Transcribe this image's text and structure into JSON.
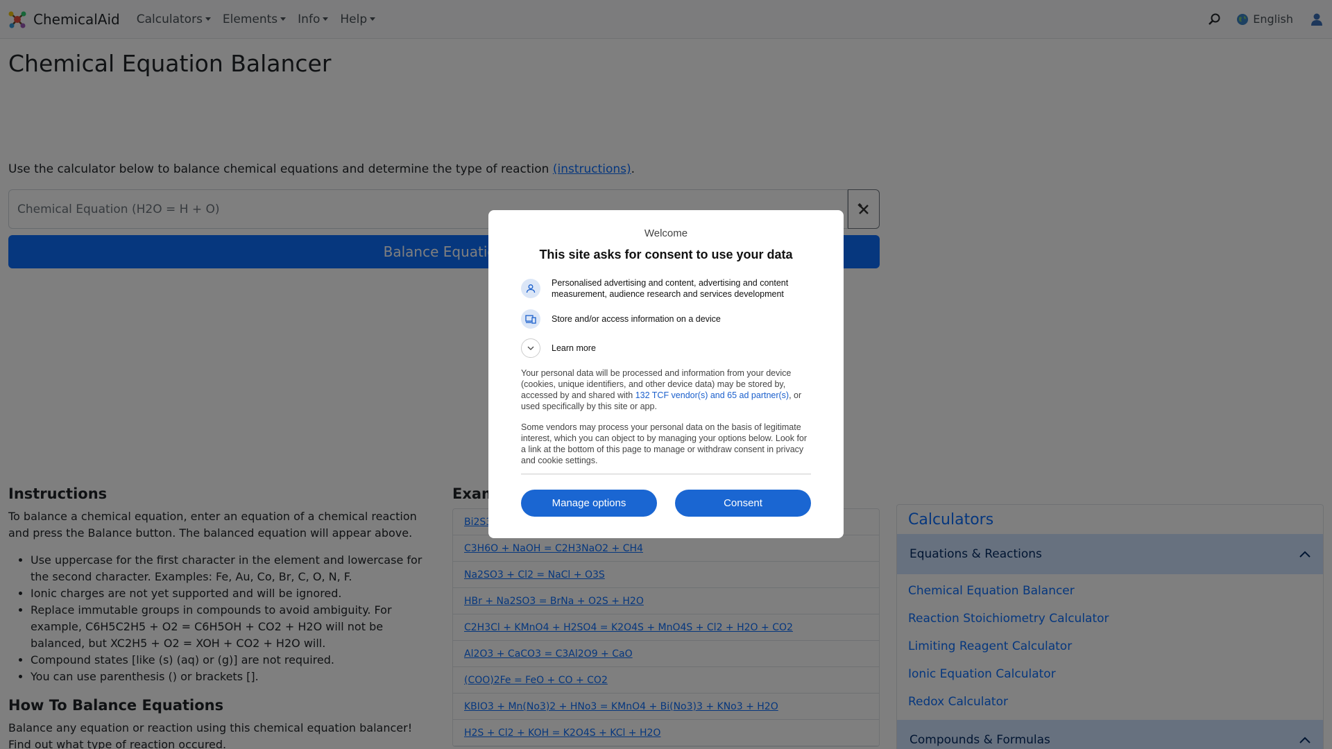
{
  "navbar": {
    "brand": "ChemicalAid",
    "menu": [
      "Calculators",
      "Elements",
      "Info",
      "Help"
    ],
    "language": "English"
  },
  "main": {
    "title": "Chemical Equation Balancer",
    "intro_text": "Use the calculator below to balance chemical equations and determine the type of reaction ",
    "intro_link": "(instructions)",
    "intro_end": ".",
    "input_placeholder": "Chemical Equation (H2O = H + O)",
    "balance_button": "Balance Equation"
  },
  "instructions": {
    "heading": "Instructions",
    "paragraph": "To balance a chemical equation, enter an equation of a chemical reaction and press the Balance button. The balanced equation will appear above.",
    "items": [
      "Use uppercase for the first character in the element and lowercase for the second character. Examples: Fe, Au, Co, Br, C, O, N, F.",
      "Ionic charges are not yet supported and will be ignored.",
      "Replace immutable groups in compounds to avoid ambiguity. For example, C6H5C2H5 + O2 = C6H5OH + CO2 + H2O will not be balanced, but XC2H5 + O2 = XOH + CO2 + H2O will.",
      "Compound states [like (s) (aq) or (g)] are not required.",
      "You can use parenthesis () or brackets []."
    ],
    "how_heading": "How To Balance Equations",
    "how_paragraph": "Balance any equation or reaction using this chemical equation balancer! Find out what type of reaction occured."
  },
  "examples": {
    "heading": "Examples",
    "items": [
      "Bi2S3 + O2 = Bi2O3 + SO2",
      "C3H6O + NaOH = C2H3NaO2 + CH4",
      "Na2SO3 + Cl2 = NaCl + O3S",
      "HBr + Na2SO3 = BrNa + O2S + H2O",
      "C2H3Cl + KMnO4 + H2SO4 = K2O4S + MnO4S + Cl2 + H2O + CO2",
      "Al2O3 + CaCO3 = C3Al2O9 + CaO",
      "(COO)2Fe = FeO + CO + CO2",
      "KBIO3 + Mn(No3)2 + HNo3 = KMnO4 + Bi(No3)3 + KNo3 + H2O",
      "H2S + Cl2 + KOH = K2O4S + KCl + H2O"
    ]
  },
  "sidebar": {
    "title": "Calculators",
    "section1": "Equations & Reactions",
    "links": [
      "Chemical Equation Balancer",
      "Reaction Stoichiometry Calculator",
      "Limiting Reagent Calculator",
      "Ionic Equation Calculator",
      "Redox Calculator"
    ],
    "section2": "Compounds & Formulas"
  },
  "consent": {
    "welcome": "Welcome",
    "title": "This site asks for consent to use your data",
    "purpose1": "Personalised advertising and content, advertising and content measurement, audience research and services development",
    "purpose2": "Store and/or access information on a device",
    "learn_more": "Learn more",
    "para1_start": "Your personal data will be processed and information from your device (cookies, unique identifiers, and other device data) may be stored by, accessed by and shared with ",
    "para1_link": "132 TCF vendor(s) and 65 ad partner(s)",
    "para1_end": ", or used specifically by this site or app.",
    "para2": "Some vendors may process your personal data on the basis of legitimate interest, which you can object to by managing your options below. Look for a link at the bottom of this page to manage or withdraw consent in privacy and cookie settings.",
    "manage_button": "Manage options",
    "consent_button": "Consent"
  }
}
